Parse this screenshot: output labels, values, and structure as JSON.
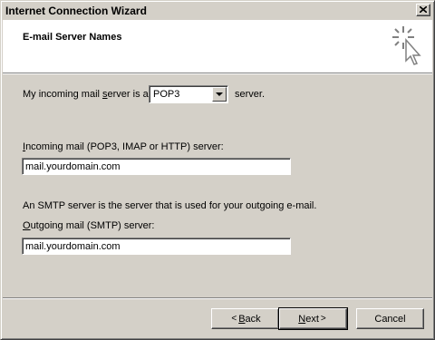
{
  "window": {
    "title": "Internet Connection Wizard",
    "close_glyph": "×"
  },
  "header": {
    "title": "E-mail Server Names",
    "icon": "wizard-cursor-icon"
  },
  "incoming_type": {
    "label_pre": "My incoming mail ",
    "label_access": "s",
    "label_post": "erver is a",
    "value": "POP3",
    "suffix": "server."
  },
  "incoming_server": {
    "label_access": "I",
    "label_rest": "ncoming mail (POP3, IMAP or HTTP) server:",
    "value": "mail.yourdomain.com"
  },
  "smtp_note": "An SMTP server is the server that is used for your outgoing e-mail.",
  "outgoing_server": {
    "label_access": "O",
    "label_rest": "utgoing mail (SMTP) server:",
    "value": "mail.yourdomain.com"
  },
  "buttons": {
    "back": {
      "arrow": "<",
      "access": "B",
      "rest": "ack"
    },
    "next": {
      "access": "N",
      "rest": "ext",
      "arrow": ">"
    },
    "cancel": "Cancel"
  }
}
